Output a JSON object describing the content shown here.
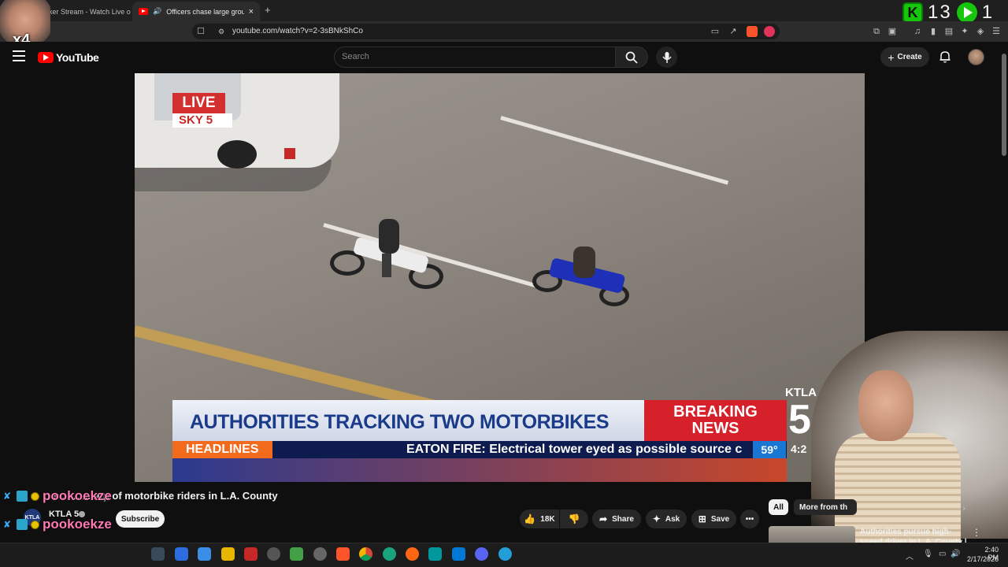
{
  "browser": {
    "tabs": [
      {
        "label": "anker Stream - Watch Live on",
        "active": false
      },
      {
        "label": "Officers chase large group of",
        "active": true
      }
    ],
    "new_tab": "+",
    "close_tab": "×",
    "url": "youtube.com/watch?v=2-3sBNkShCo"
  },
  "overlay": {
    "counter_a": "13",
    "counter_b": "1",
    "multiplier": "x4"
  },
  "youtube": {
    "logo_text": "YouTube",
    "search_placeholder": "Search",
    "create_label": "Create"
  },
  "video": {
    "live_label": "LIVE",
    "station_label": "SKY 5",
    "headline": "AUTHORITIES TRACKING TWO MOTORBIKES",
    "breaking_line1": "BREAKING",
    "breaking_line2": "NEWS",
    "headlines_label": "HEADLINES",
    "ticker": "EATON FIRE: Electrical tower eyed as possible source c",
    "temperature": "59°",
    "time": "4:2",
    "network_logo": "KTLA",
    "network_number": "5"
  },
  "watch": {
    "title": "s... ... ...oup of motorbike riders in L.A. County",
    "channel_name": "KTLA 5",
    "channel_avatar_text": "KTLA",
    "subscribe_label": "Subscribe",
    "likes": "18K",
    "share_label": "Share",
    "ask_label": "Ask",
    "save_label": "Save"
  },
  "chat": {
    "lines": [
      {
        "name": "pookoekze"
      },
      {
        "name": "pookoekze"
      },
      {
        "name": "pookoekze"
      }
    ]
  },
  "sidebar": {
    "chip_all": "All",
    "chip_more": "More from th",
    "rec_title": "Authorities pursue high-speed driver in L.A. County | Los"
  },
  "taskbar": {
    "time": "2:40 PM",
    "date": "2/17/2026"
  },
  "colors": {
    "youtube_red": "#ff0000",
    "overlay_green": "#16c60c",
    "chat_name": "#ff7ab6",
    "breaking_red": "#d6202a",
    "headline_blue": "#1a3a8a"
  }
}
